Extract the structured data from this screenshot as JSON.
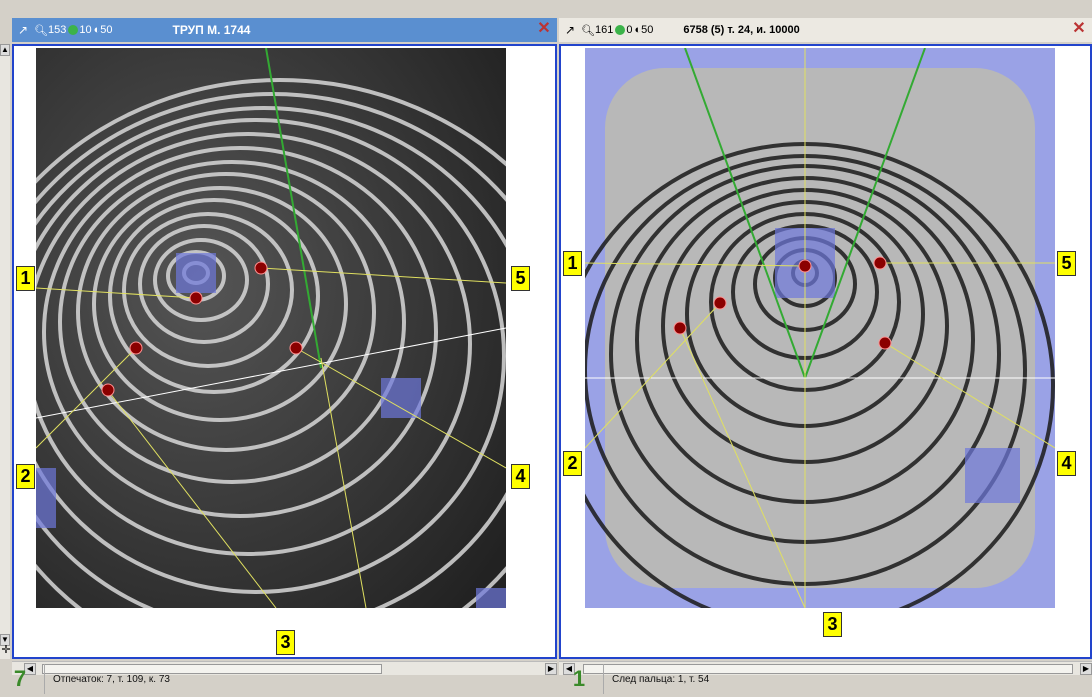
{
  "left_pane": {
    "stats": {
      "search": "153",
      "green": "10",
      "dial": "50"
    },
    "title": "ТРУП М. 1744",
    "close": "✕",
    "markers": [
      "1",
      "2",
      "3",
      "4",
      "5"
    ],
    "status_num": "7",
    "status_text": "Отпечаток: 7, т. 109, к. 73"
  },
  "right_pane": {
    "stats": {
      "search": "161",
      "green": "0",
      "dial": "50"
    },
    "title": "6758 (5)   т. 24, и. 10000",
    "close": "✕",
    "markers": [
      "1",
      "2",
      "3",
      "4",
      "5"
    ],
    "status_num": "1",
    "status_text": "След пальца: 1, т. 54"
  },
  "colors": {
    "active_title": "#5a8fd0",
    "frame_border": "#2244cc",
    "marker_label": "#ffff00",
    "minutia": "#8b0000",
    "ray_line": "#e0e060",
    "axis_line": "#33aa33",
    "highlight": "#6e78dc"
  }
}
